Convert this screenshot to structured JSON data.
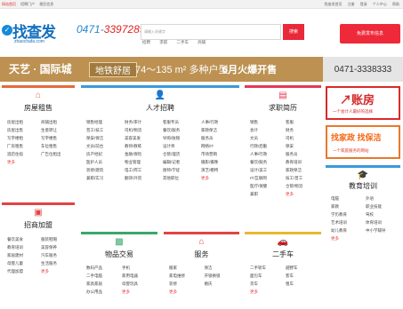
{
  "topbar": {
    "left": [
      "网站首页",
      "招聘门户",
      "便民信息"
    ],
    "right": [
      "找查发首页",
      "注册",
      "登录",
      "个人中心",
      "帮助"
    ]
  },
  "header": {
    "logo_name": "找查发",
    "logo_domain": "zhaochafa.com",
    "phone_prefix": "0471-",
    "phone_highlight": "3397289",
    "search_placeholder": "请输入关键字",
    "search_button": "搜索",
    "hotwords": [
      "招聘",
      "求职",
      "二手车",
      "商铺"
    ],
    "post_button": "免费发布信息"
  },
  "banner": {
    "t1": "天艺 · 国际城",
    "t2": "地铁舒居",
    "t3": "74～135 m² 多种户型",
    "t4": "6月火爆开售",
    "phone": "0471-3338333"
  },
  "panels": {
    "house": {
      "title": "房屋租售",
      "items": [
        "房屋出租",
        "商铺出租",
        "房屋出售",
        "生意转让",
        "写字楼租",
        "写字楼售",
        "厂房租售",
        "车位租售",
        "酒店住宿",
        "广告位租出",
        "更多"
      ]
    },
    "jobs": {
      "title": "人才招聘",
      "items": [
        "销售经理",
        "财务/审计",
        "客服专员",
        "人事/行政",
        "普工/技工",
        "司机/物流",
        "餐饮/服务",
        "家政保洁",
        "保安/保洁",
        "美容美发",
        "导购/收银",
        "服务员",
        "文员/前台",
        "教师/教练",
        "设计师",
        "网络/IT",
        "房产经纪",
        "金融/保险",
        "仓管/理货",
        "市场营销",
        "医护人员",
        "物业管理",
        "编辑/记者",
        "摄影/摄像",
        "装修/建筑",
        "电工/焊工",
        "厨师/学徒",
        "演艺/模特",
        "兼职/实习",
        "翻译/外贸",
        "其他职位",
        "更多"
      ]
    },
    "resume": {
      "title": "求职简历",
      "items": [
        "销售",
        "客服",
        "会计",
        "财务",
        "文员",
        "司机",
        "行政/后勤",
        "保安",
        "人事/行政",
        "服务员",
        "餐饮/服务",
        "教育培训",
        "设计/美工",
        "家政保洁",
        "IT/互联网",
        "技工/普工",
        "医疗/保健",
        "仓管/物流",
        "兼职",
        "更多"
      ]
    },
    "edu": {
      "title": "教育培训",
      "items": [
        "电脑",
        "外语",
        "家教",
        "职业技能",
        "学历教育",
        "驾校",
        "艺术培训",
        "体育培训",
        "幼儿教育",
        "中小学辅导",
        "更多"
      ]
    },
    "invest": {
      "title": "招商加盟",
      "items": [
        "餐饮美食",
        "服装鞋帽",
        "教育培训",
        "美容保养",
        "家居建材",
        "汽车服务",
        "母婴儿童",
        "生活服务",
        "代理加盟",
        "更多"
      ]
    },
    "goods": {
      "title": "物品交易",
      "items": [
        "数码产品",
        "手机",
        "二手电脑",
        "家用电器",
        "家具家居",
        "母婴玩具",
        "办公用品",
        "更多"
      ]
    },
    "service": {
      "title": "服务",
      "items": [
        "搬家",
        "保洁",
        "家电维修",
        "开锁换锁",
        "装修",
        "婚庆",
        "更多"
      ]
    },
    "car": {
      "title": "二手车",
      "items": [
        "二手轿车",
        "越野车",
        "面包车",
        "客车",
        "货车",
        "租车",
        "更多"
      ]
    }
  },
  "ads": {
    "ad1_main": "↗账房",
    "ad1_sub": "一个会计人最好的选择",
    "ad2_main": "找家政 找保洁",
    "ad2_sub": "一个家庭服务的网站"
  },
  "colors": {
    "house": "#e46a3a",
    "jobs": "#3a9bd8",
    "resume": "#e23a55",
    "edu": "#3a9bd8",
    "invest": "#e04444",
    "goods": "#3aa86a",
    "service": "#e04444",
    "car": "#e8b830"
  }
}
